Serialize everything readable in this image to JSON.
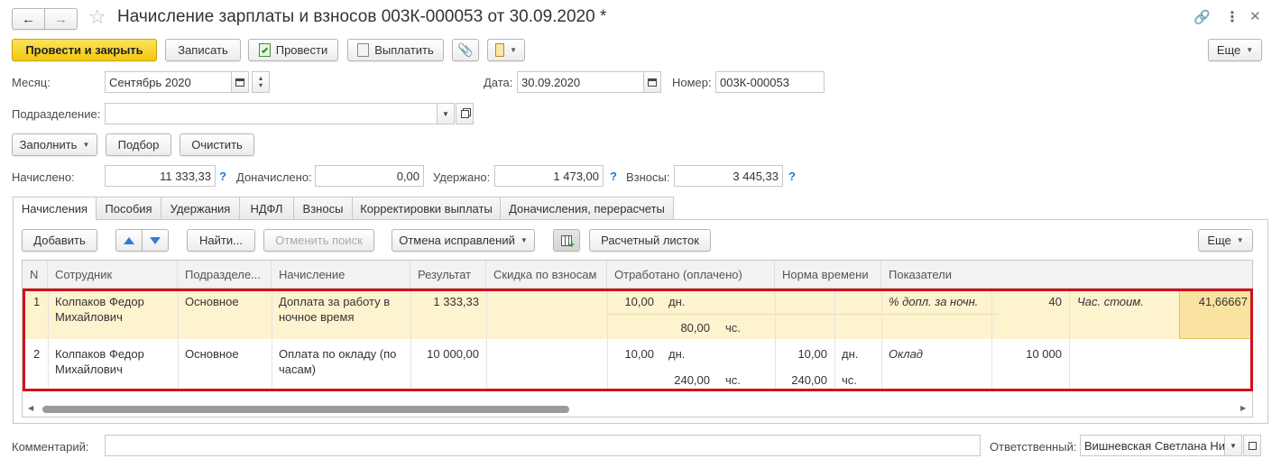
{
  "window": {
    "title": "Начисление зарплаты и взносов 003К-000053 от 30.09.2020 *"
  },
  "toolbar": {
    "post_close": "Провести и закрыть",
    "save": "Записать",
    "post": "Провести",
    "pay": "Выплатить",
    "more": "Еще"
  },
  "header": {
    "month_label": "Месяц:",
    "month_value": "Сентябрь 2020",
    "date_label": "Дата:",
    "date_value": "30.09.2020",
    "number_label": "Номер:",
    "number_value": "003К-000053",
    "department_label": "Подразделение:",
    "department_value": ""
  },
  "actions": {
    "fill": "Заполнить",
    "select": "Подбор",
    "clear": "Очистить"
  },
  "totals": {
    "accrued_label": "Начислено:",
    "accrued_value": "11 333,33",
    "extra_label": "Доначислено:",
    "extra_value": "0,00",
    "withheld_label": "Удержано:",
    "withheld_value": "1 473,00",
    "contrib_label": "Взносы:",
    "contrib_value": "3 445,33",
    "help": "?"
  },
  "tabs": [
    {
      "label": "Начисления"
    },
    {
      "label": "Пособия"
    },
    {
      "label": "Удержания"
    },
    {
      "label": "НДФЛ"
    },
    {
      "label": "Взносы"
    },
    {
      "label": "Корректировки выплаты"
    },
    {
      "label": "Доначисления, перерасчеты"
    }
  ],
  "table_toolbar": {
    "add": "Добавить",
    "find": "Найти...",
    "cancel_search": "Отменить поиск",
    "cancel_fixes": "Отмена исправлений",
    "payslip": "Расчетный листок",
    "more": "Еще"
  },
  "table": {
    "columns": [
      "N",
      "Сотрудник",
      "Подразделе...",
      "Начисление",
      "Результат",
      "Скидка по взносам",
      "Отработано (оплачено)",
      "Норма времени",
      "Показатели"
    ],
    "rows": [
      {
        "n": "1",
        "employee_1": "Колпаков Федор",
        "employee_2": "Михайлович",
        "department": "Основное",
        "accrual_1": "Доплата за работу в",
        "accrual_2": "ночное время",
        "result": "1 333,33",
        "worked_days": "10,00",
        "worked_days_unit": "дн.",
        "worked_hours": "80,00",
        "worked_hours_unit": "чс.",
        "norm_days": "",
        "norm_days_unit": "",
        "norm_hours": "",
        "norm_hours_unit": "",
        "ind1_name": "% допл. за ночн.",
        "ind1_value": "40",
        "ind2_name": "Час. стоим.",
        "ind2_value": "41,66667"
      },
      {
        "n": "2",
        "employee_1": "Колпаков Федор",
        "employee_2": "Михайлович",
        "department": "Основное",
        "accrual_1": "Оплата по окладу (по",
        "accrual_2": "часам)",
        "result": "10 000,00",
        "worked_days": "10,00",
        "worked_days_unit": "дн.",
        "worked_hours": "240,00",
        "worked_hours_unit": "чс.",
        "norm_days": "10,00",
        "norm_days_unit": "дн.",
        "norm_hours": "240,00",
        "norm_hours_unit": "чс.",
        "ind1_name": "Оклад",
        "ind1_value": "10 000",
        "ind2_name": "",
        "ind2_value": ""
      }
    ]
  },
  "footer": {
    "comment_label": "Комментарий:",
    "comment_value": "",
    "responsible_label": "Ответственный:",
    "responsible_value": "Вишневская Светлана Ни"
  },
  "colors": {
    "primary_button": "#f2c70f",
    "selected_row": "#fdf3cf",
    "highlight_border": "#d0121b",
    "help_icon": "#1f7ad0"
  }
}
